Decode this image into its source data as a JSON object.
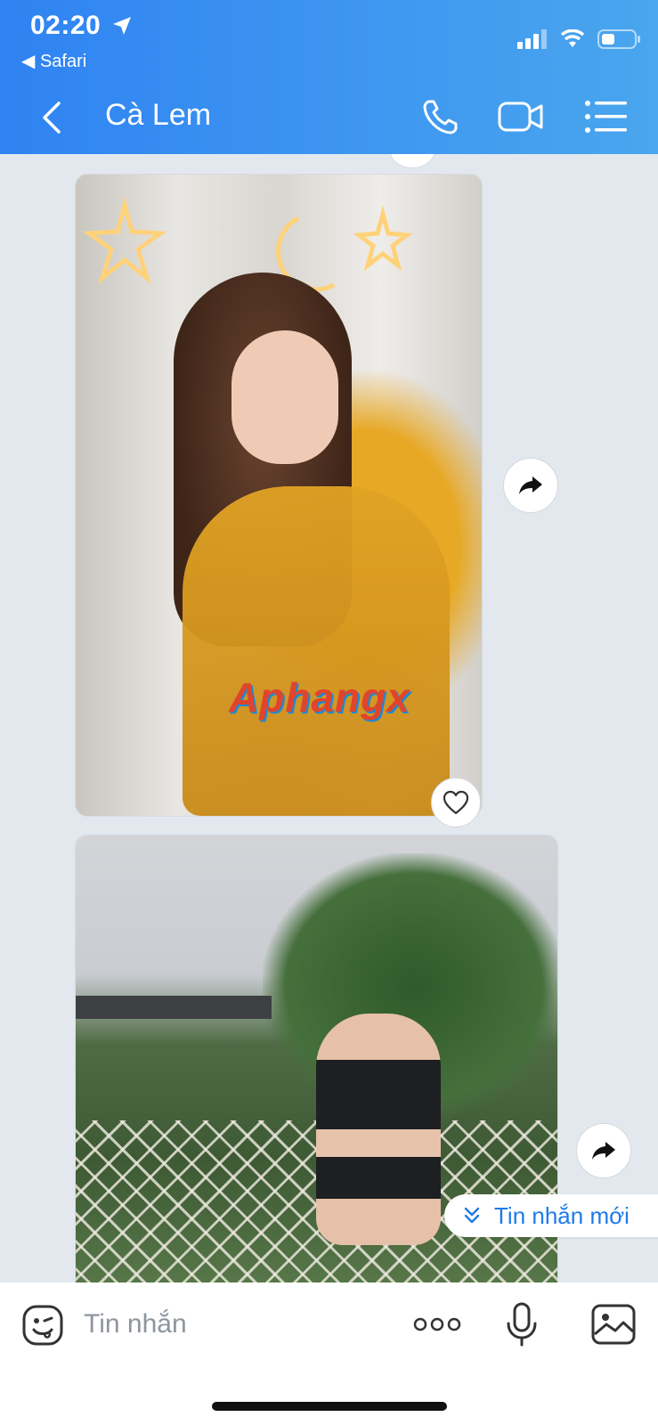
{
  "status_bar": {
    "time": "02:20",
    "back_app": "Safari",
    "icons": [
      "location-arrow-icon",
      "signal-icon",
      "wifi-icon",
      "battery-icon"
    ]
  },
  "header": {
    "title": "Cà Lem",
    "icons": [
      "back-icon",
      "phone-icon",
      "video-call-icon",
      "menu-list-icon"
    ]
  },
  "messages": [
    {
      "type": "image",
      "description_icon": "photo",
      "watermark": "Aphangx",
      "actions": [
        "share-icon",
        "heart-icon"
      ]
    },
    {
      "type": "image",
      "description_icon": "photo",
      "actions": [
        "share-icon"
      ]
    }
  ],
  "new_message_pill": {
    "label": "Tin nhắn mới"
  },
  "composer": {
    "placeholder": "Tin nhắn",
    "icons": [
      "sticker-icon",
      "more-icon",
      "microphone-icon",
      "image-icon"
    ]
  },
  "colors": {
    "header_start": "#2f83f2",
    "header_end": "#4aa6ee",
    "chat_bg": "#e3e8ef",
    "accent": "#1e7ae8"
  }
}
